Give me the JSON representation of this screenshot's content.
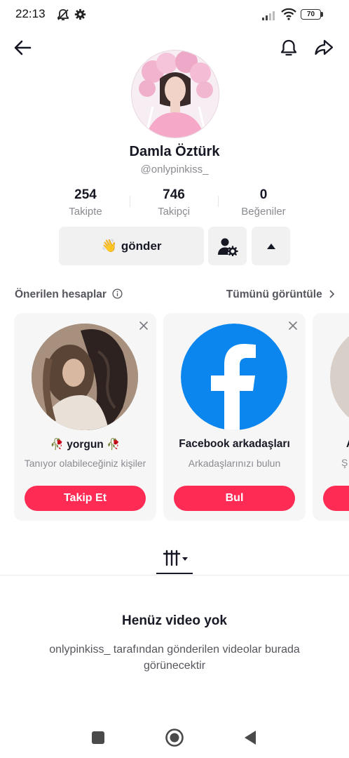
{
  "status_bar": {
    "time": "22:13",
    "battery": "70",
    "icons": [
      "mute-icon",
      "gear-icon",
      "signal-icon",
      "wifi-icon",
      "battery-icon"
    ]
  },
  "header": {
    "back_icon": "back-arrow-icon",
    "bell_icon": "bell-icon",
    "share_icon": "share-icon"
  },
  "profile": {
    "name": "Damla Öztürk",
    "handle": "@onlypinkiss_",
    "stats": [
      {
        "value": "254",
        "label": "Takipte"
      },
      {
        "value": "746",
        "label": "Takipçi"
      },
      {
        "value": "0",
        "label": "Beğeniler"
      }
    ],
    "send_button": {
      "emoji": "👋",
      "label": "gönder"
    },
    "accent_color": "#fe2c55"
  },
  "suggestions": {
    "title": "Önerilen hesaplar",
    "see_all": "Tümünü görüntüle",
    "cards": [
      {
        "name": "🥀 yorgun 🥀",
        "subtitle": "Tanıyor olabileceğiniz kişiler",
        "button": "Takip Et"
      },
      {
        "name": "Facebook arkadaşları",
        "subtitle": "Arkadaşlarınızı bulun",
        "button": "Bul"
      },
      {
        "name": "A",
        "subtitle": "Ş",
        "button": ""
      }
    ]
  },
  "videos": {
    "empty_title": "Henüz video yok",
    "empty_desc": "onlypinkiss_ tarafından gönderilen videolar burada görünecektir"
  },
  "nav_bar": {
    "buttons": [
      "recent-apps-icon",
      "home-icon",
      "back-icon"
    ]
  }
}
